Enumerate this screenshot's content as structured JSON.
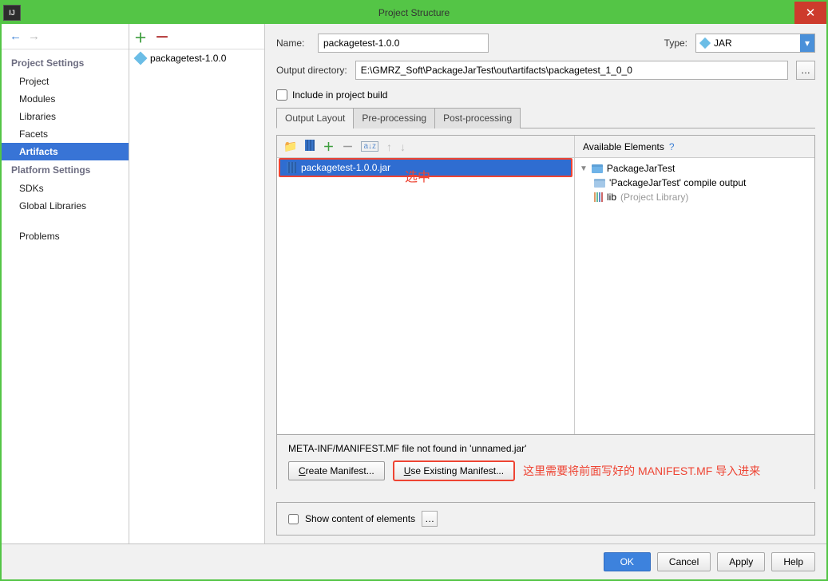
{
  "window": {
    "title": "Project Structure"
  },
  "sidebar": {
    "settingsHeader": "Project Settings",
    "items": [
      "Project",
      "Modules",
      "Libraries",
      "Facets",
      "Artifacts"
    ],
    "platformHeader": "Platform Settings",
    "platformItems": [
      "SDKs",
      "Global Libraries"
    ],
    "problems": "Problems"
  },
  "artifactList": {
    "item": "packagetest-1.0.0"
  },
  "form": {
    "nameLabel": "Name:",
    "nameValue": "packagetest-1.0.0",
    "typeLabel": "Type:",
    "typeValue": "JAR",
    "outputLabel": "Output directory:",
    "outputValue": "E:\\GMRZ_Soft\\PackageJarTest\\out\\artifacts\\packagetest_1_0_0",
    "includeLabel": "Include in project build"
  },
  "tabs": {
    "t1": "Output Layout",
    "t2": "Pre-processing",
    "t3": "Post-processing"
  },
  "layout": {
    "jarName": "packagetest-1.0.0.jar",
    "annotationSelect": "选中",
    "availHeader": "Available Elements",
    "availTree": {
      "root": "PackageJarTest",
      "compile": "'PackageJarTest' compile output",
      "libPrefix": "lib",
      "libSuffix": "(Project Library)"
    },
    "notFound": "META-INF/MANIFEST.MF file not found in 'unnamed.jar'",
    "createBtn": "Create Manifest...",
    "useBtn": "Use Existing Manifest...",
    "annotationImport": "这里需要将前面写好的 MANIFEST.MF 导入进来"
  },
  "showContent": "Show content of elements",
  "buttons": {
    "ok": "OK",
    "cancel": "Cancel",
    "apply": "Apply",
    "help": "Help"
  }
}
